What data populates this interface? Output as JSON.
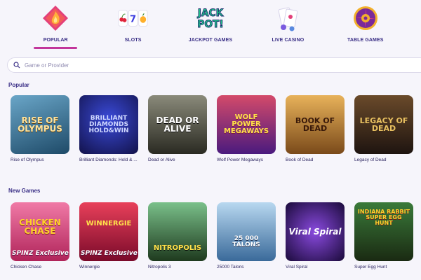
{
  "categories": [
    {
      "label": "POPULAR",
      "icon": "flame-diamond-icon",
      "active": true
    },
    {
      "label": "SLOTS",
      "icon": "slot-symbols-icon",
      "active": false
    },
    {
      "label": "JACKPOT GAMES",
      "icon": "jackpot-logo-icon",
      "active": false
    },
    {
      "label": "LIVE CASINO",
      "icon": "playing-cards-icon",
      "active": false
    },
    {
      "label": "TABLE GAMES",
      "icon": "roulette-wheel-icon",
      "active": false
    }
  ],
  "jackpot_icon_text": {
    "line1": "JACK",
    "line2": "POT!"
  },
  "slots_icon_digit": "7",
  "search": {
    "placeholder": "Game or Provider"
  },
  "sections": {
    "popular": {
      "title": "Popular",
      "games": [
        {
          "name": "Rise of Olympus",
          "art_text": "Rise of Olympus",
          "bg": "#2b6a86"
        },
        {
          "name": "Brilliant Diamonds: Hold & ...",
          "art_text": "Brilliant Diamonds Hold&Win",
          "bg": "#1b1d6e"
        },
        {
          "name": "Dead or Alive",
          "art_text": "Dead or Alive",
          "bg": "#3a3a2e"
        },
        {
          "name": "Wolf Power Megaways",
          "art_text": "Wolf Power Megaways",
          "bg": "#6b2a86"
        },
        {
          "name": "Book of Dead",
          "art_text": "Book of Dead",
          "bg": "#a86e2a"
        },
        {
          "name": "Legacy of Dead",
          "art_text": "Legacy of Dead",
          "bg": "#3a2a22"
        }
      ]
    },
    "new_games": {
      "title": "New Games",
      "games": [
        {
          "name": "Chicken Chase",
          "art_text": "Chicken Chase",
          "badge": "SPINZ Exclusive",
          "bg": "#d84a7a"
        },
        {
          "name": "Winnergie",
          "art_text": "Winnergie",
          "badge": "SPINZ Exclusive",
          "bg": "#c0244a"
        },
        {
          "name": "Nitropolis 3",
          "art_text": "Nitropolis",
          "badge": "",
          "bg": "#3b6b3a"
        },
        {
          "name": "25000 Talons",
          "art_text": "25 000 Talons",
          "badge": "",
          "bg": "#5d8fb8"
        },
        {
          "name": "Viral Spiral",
          "art_text": "Viral Spiral",
          "badge": "",
          "bg": "#3a1a6e"
        },
        {
          "name": "Super Egg Hunt",
          "art_text": "Indiana Rabbit Super Egg Hunt",
          "badge": "",
          "bg": "#2b5a2a"
        }
      ]
    }
  }
}
